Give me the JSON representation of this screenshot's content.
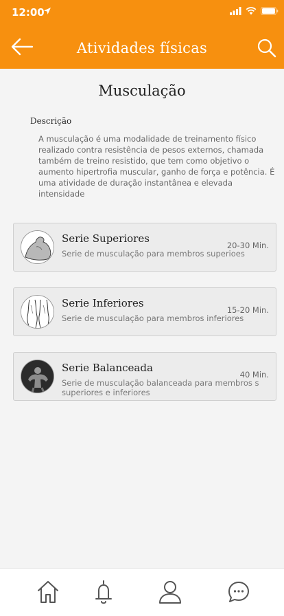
{
  "status_bar": {
    "time": "12:00"
  },
  "header": {
    "title": "Atividades físicas",
    "back_icon": "arrow-left-icon",
    "search_icon": "search-icon",
    "background": "#f7900f"
  },
  "page": {
    "title": "Musculação",
    "description_label": "Descrição",
    "description_text": "A musculação é uma modalidade de treinamento físico realizado contra resistência de pesos externos, chamada também de treino resistido, que tem como objetivo o aumento hipertrofia muscular, ganho de força e potência. É uma atividade de duração instantânea e elevada intensidade"
  },
  "cards": [
    {
      "title": "Serie Superiores",
      "duration": "20-30 Min.",
      "description": "Serie de musculação para membros superioes",
      "icon": "arm-muscle-icon"
    },
    {
      "title": "Serie Inferiores",
      "duration": "15-20 Min.",
      "description": "Serie de musculação para membros inferiores",
      "icon": "legs-icon"
    },
    {
      "title": "Serie Balanceada",
      "duration": "40 Min.",
      "description": "Serie de musculação balanceada para membros s superiores e inferiores",
      "icon": "bodybuilder-icon"
    }
  ],
  "tabbar": {
    "items": [
      "home-icon",
      "bell-icon",
      "user-icon",
      "chat-icon"
    ]
  }
}
